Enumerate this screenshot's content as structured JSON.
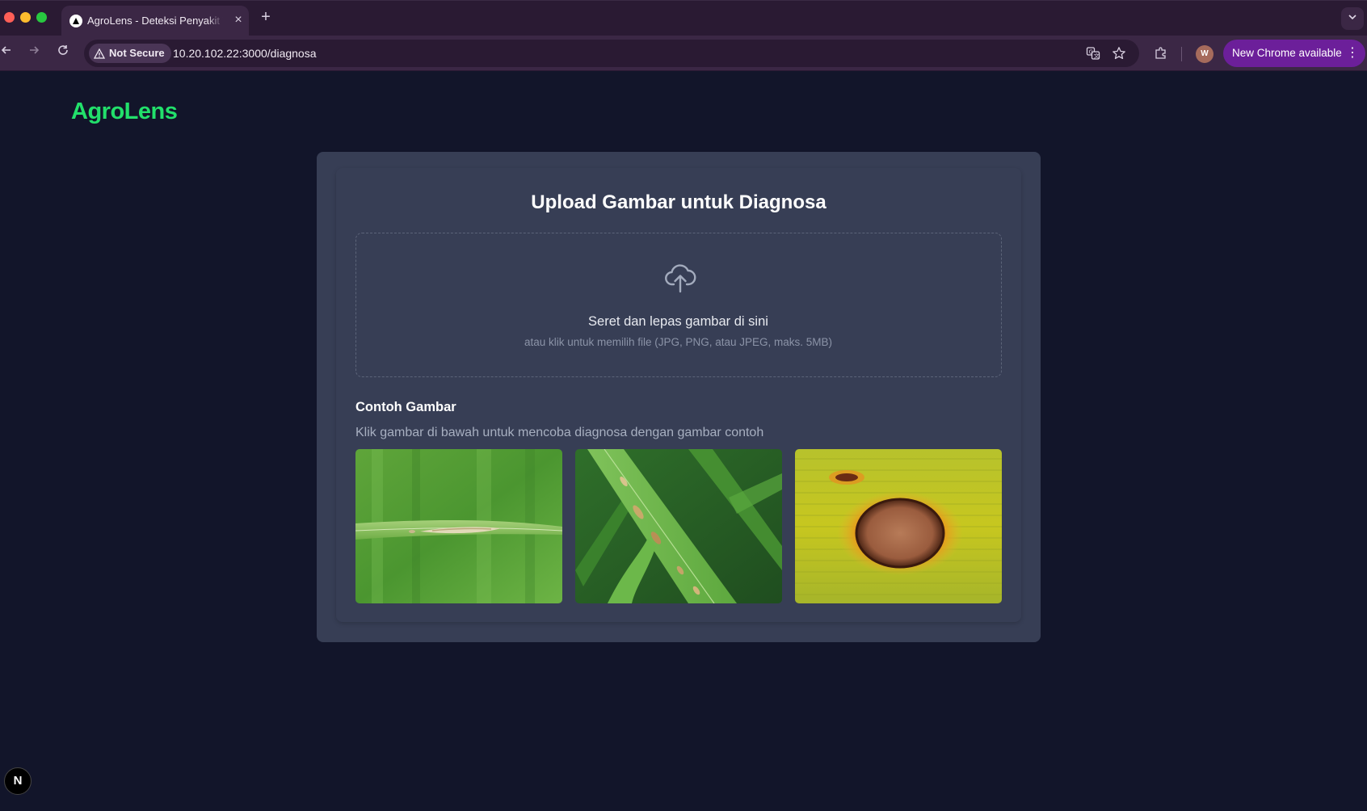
{
  "browser": {
    "tab_title": "AgroLens - Deteksi Penyakit Tanaman",
    "tab_close": "×",
    "new_tab": "+",
    "security_label": "Not Secure",
    "url": "10.20.102.22:3000/diagnosa",
    "profile_initial": "W",
    "update_label": "New Chrome available",
    "update_menu": "⋮"
  },
  "app": {
    "brand": "AgroLens",
    "brand_color": "#22e06b"
  },
  "upload": {
    "title": "Upload Gambar untuk Diagnosa",
    "drop_text": "Seret dan lepas gambar di sini",
    "drop_hint": "atau klik untuk memilih file (JPG, PNG, atau JPEG, maks. 5MB)",
    "icon": "cloud-upload-icon"
  },
  "examples": {
    "title": "Contoh Gambar",
    "description": "Klik gambar di bawah untuk mencoba diagnosa dengan gambar contoh"
  },
  "dev_badge": "N"
}
